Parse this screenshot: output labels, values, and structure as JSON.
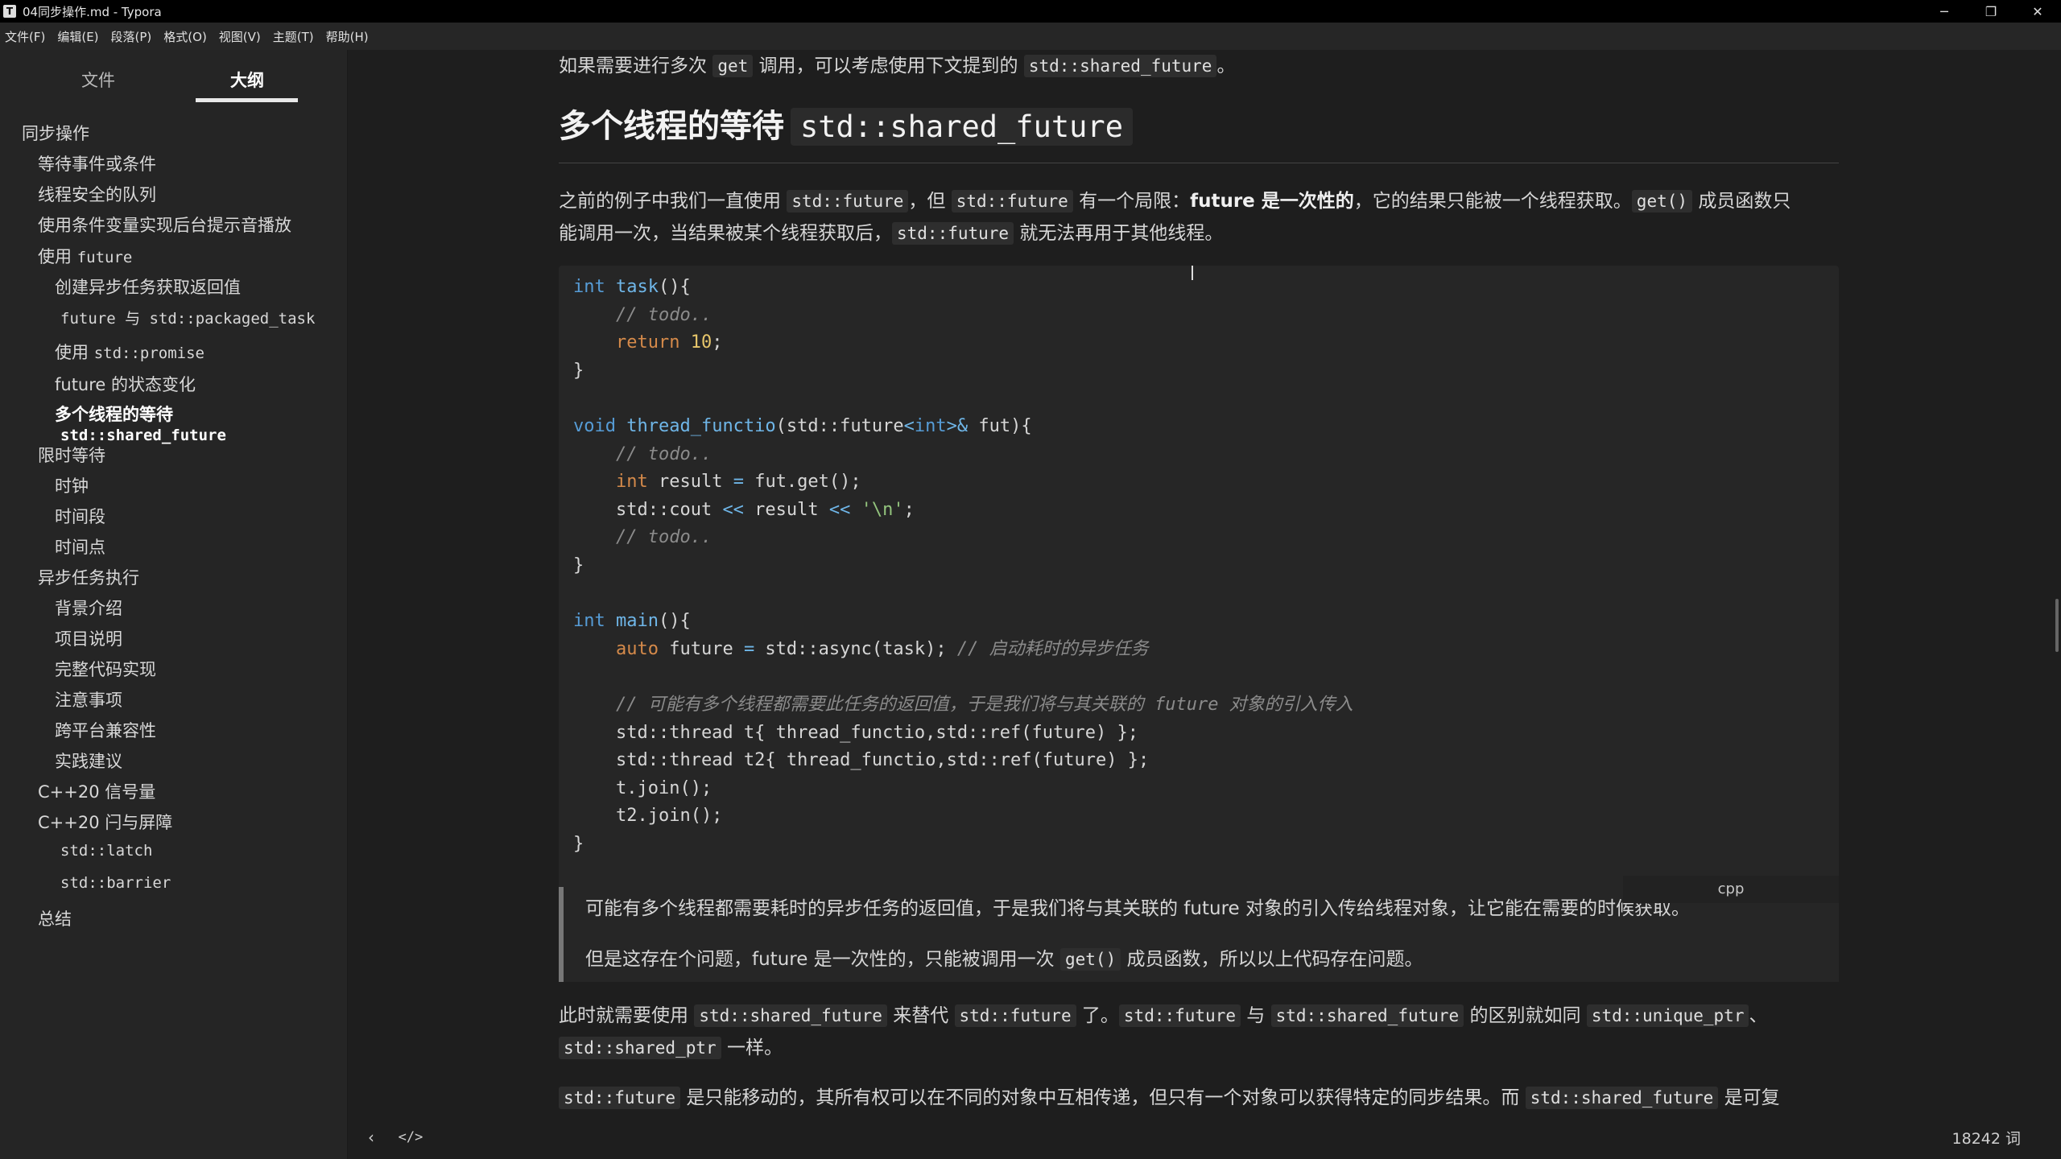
{
  "window": {
    "title": "04同步操作.md - Typora",
    "app_icon": "T"
  },
  "menu": [
    "文件(F)",
    "编辑(E)",
    "段落(P)",
    "格式(O)",
    "视图(V)",
    "主题(T)",
    "帮助(H)"
  ],
  "sidebar": {
    "tab_files": "文件",
    "tab_outline": "大纲",
    "outline": [
      {
        "text": "同步操作",
        "level": 1
      },
      {
        "text": "等待事件或条件",
        "level": 2
      },
      {
        "text": "线程安全的队列",
        "level": 2
      },
      {
        "text": "使用条件变量实现后台提示音播放",
        "level": 2
      },
      {
        "text": "使用 ",
        "code": "future",
        "level": 2
      },
      {
        "text": "创建异步任务获取返回值",
        "level": 3
      },
      {
        "text": "future 与 std::packaged_task",
        "level": 3,
        "mono": true
      },
      {
        "text": "使用 ",
        "code": "std::promise",
        "level": 3
      },
      {
        "text": "future 的状态变化",
        "level": 3
      },
      {
        "text": "多个线程的等待",
        "code": "std::shared_future",
        "level": 3,
        "active": true
      },
      {
        "text": "限时等待",
        "level": 2
      },
      {
        "text": "时钟",
        "level": 3
      },
      {
        "text": "时间段",
        "level": 3
      },
      {
        "text": "时间点",
        "level": 3
      },
      {
        "text": "异步任务执行",
        "level": 2
      },
      {
        "text": "背景介绍",
        "level": 3
      },
      {
        "text": "项目说明",
        "level": 3
      },
      {
        "text": "完整代码实现",
        "level": 3
      },
      {
        "text": "注意事项",
        "level": 3
      },
      {
        "text": "跨平台兼容性",
        "level": 3
      },
      {
        "text": "实践建议",
        "level": 3
      },
      {
        "text": "C++20 信号量",
        "level": 2
      },
      {
        "text": "C++20 闩与屏障",
        "level": 2
      },
      {
        "text": "std::latch",
        "level": 3,
        "mono": true
      },
      {
        "text": "std::barrier",
        "level": 3,
        "mono": true
      },
      {
        "text": "总结",
        "level": 2
      }
    ]
  },
  "doc": {
    "top_line": {
      "a": "如果需要进行多次 ",
      "c1": "get",
      "b": " 调用，可以考虑使用下文提到的 ",
      "c2": "std::shared_future",
      "d": "。"
    },
    "heading": {
      "text": "多个线程的等待",
      "code": "std::shared_future"
    },
    "para1": {
      "a": "之前的例子中我们一直使用 ",
      "c1": "std::future",
      "b": "，但 ",
      "c2": "std::future",
      "c": " 有一个局限：",
      "bold": "future 是一次性的",
      "d": "，它的结果只能被一个线程获取。",
      "c3": "get()",
      "e": " 成员函数只",
      "line2a": "能调用一次，当结果被某个线程获取后，",
      "c4": "std::future",
      "line2b": " 就无法再用于其他线程。"
    },
    "code_lang": "cpp",
    "code": [
      [
        [
          "kw",
          "int"
        ],
        [
          "tx",
          " "
        ],
        [
          "fn",
          "task"
        ],
        [
          "tx",
          "(){"
        ]
      ],
      [
        [
          "tx",
          "    "
        ],
        [
          "cm",
          "// todo.."
        ]
      ],
      [
        [
          "tx",
          "    "
        ],
        [
          "kw2",
          "return"
        ],
        [
          "tx",
          " "
        ],
        [
          "num",
          "10"
        ],
        [
          "tx",
          ";"
        ]
      ],
      [
        [
          "tx",
          "}"
        ]
      ],
      [
        [
          "tx",
          ""
        ]
      ],
      [
        [
          "kw",
          "void"
        ],
        [
          "tx",
          " "
        ],
        [
          "fn",
          "thread_functio"
        ],
        [
          "tx",
          "(std::future"
        ],
        [
          "op",
          "<"
        ],
        [
          "kw",
          "int"
        ],
        [
          "op",
          ">&"
        ],
        [
          "tx",
          " fut){"
        ]
      ],
      [
        [
          "tx",
          "    "
        ],
        [
          "cm",
          "// todo.."
        ]
      ],
      [
        [
          "tx",
          "    "
        ],
        [
          "kw2",
          "int"
        ],
        [
          "tx",
          " result "
        ],
        [
          "op",
          "="
        ],
        [
          "tx",
          " fut.get();"
        ]
      ],
      [
        [
          "tx",
          "    std::cout "
        ],
        [
          "op",
          "<<"
        ],
        [
          "tx",
          " result "
        ],
        [
          "op",
          "<<"
        ],
        [
          "tx",
          " "
        ],
        [
          "str",
          "'\\n'"
        ],
        [
          "tx",
          ";"
        ]
      ],
      [
        [
          "tx",
          "    "
        ],
        [
          "cm",
          "// todo.."
        ]
      ],
      [
        [
          "tx",
          "}"
        ]
      ],
      [
        [
          "tx",
          ""
        ]
      ],
      [
        [
          "kw",
          "int"
        ],
        [
          "tx",
          " "
        ],
        [
          "fn",
          "main"
        ],
        [
          "tx",
          "(){"
        ]
      ],
      [
        [
          "tx",
          "    "
        ],
        [
          "kw2",
          "auto"
        ],
        [
          "tx",
          " future "
        ],
        [
          "op",
          "="
        ],
        [
          "tx",
          " std::async(task); "
        ],
        [
          "cm",
          "// 启动耗时的异步任务"
        ]
      ],
      [
        [
          "tx",
          ""
        ]
      ],
      [
        [
          "tx",
          "    "
        ],
        [
          "cm",
          "// 可能有多个线程都需要此任务的返回值，于是我们将与其关联的 future 对象的引入传入"
        ]
      ],
      [
        [
          "tx",
          "    std::thread t{ thread_functio,std::ref(future) };"
        ]
      ],
      [
        [
          "tx",
          "    std::thread t2{ thread_functio,std::ref(future) };"
        ]
      ],
      [
        [
          "tx",
          "    t.join();"
        ]
      ],
      [
        [
          "tx",
          "    t2.join();"
        ]
      ],
      [
        [
          "tx",
          "}"
        ]
      ]
    ],
    "quote1": "可能有多个线程都需要耗时的异步任务的返回值，于是我们将与其关联的 future 对象的引入传给线程对象，让它能在需要的时候获取。",
    "quote2": {
      "a": "但是这存在个问题，future 是一次性的，只能被调用一次 ",
      "c": "get()",
      "b": " 成员函数，所以以上代码存在问题。"
    },
    "para2": {
      "a": "此时就需要使用 ",
      "c1": "std::shared_future",
      "b": " 来替代 ",
      "c2": "std::future",
      "c": " 了。",
      "c3": "std::future",
      "d": " 与 ",
      "c4": "std::shared_future",
      "e": " 的区别就如同 ",
      "c5": "std::unique_ptr",
      "f": "、",
      "c6": "std::shared_ptr",
      "g": " 一样。"
    },
    "para3": {
      "c1": "std::future",
      "a": " 是只能移动的，其所有权可以在不同的对象中互相传递，但只有一个对象可以获得特定的同步结果。而 ",
      "c2": "std::shared_future",
      "b": " 是可复"
    }
  },
  "status": {
    "back_icon": "‹",
    "source_icon": "</>",
    "word_count": "18242 词"
  }
}
